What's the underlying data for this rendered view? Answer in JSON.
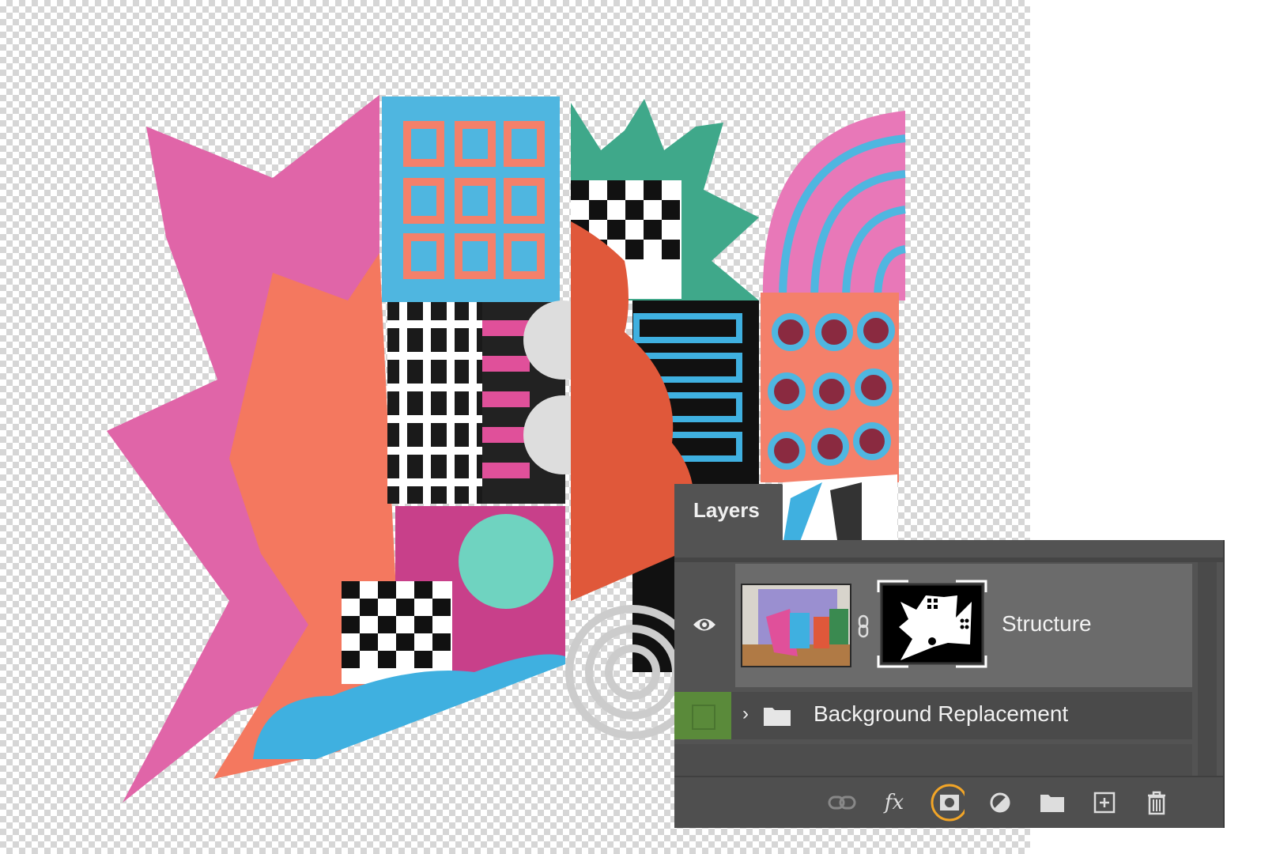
{
  "panel": {
    "tab_label": "Layers",
    "layers": [
      {
        "name": "Structure",
        "visible": true,
        "selected": true,
        "has_mask": true
      },
      {
        "name": "Background Replacement",
        "type": "group",
        "collapsed": true,
        "label_color": "#5a8a3a"
      }
    ],
    "toolbar": [
      {
        "icon": "link-layers-icon"
      },
      {
        "icon": "fx-icon",
        "label": "fx"
      },
      {
        "icon": "add-mask-icon",
        "highlighted": true,
        "highlight_color": "#f2a527"
      },
      {
        "icon": "adjustment-layer-icon"
      },
      {
        "icon": "new-group-icon"
      },
      {
        "icon": "new-layer-icon"
      },
      {
        "icon": "delete-icon"
      }
    ]
  }
}
